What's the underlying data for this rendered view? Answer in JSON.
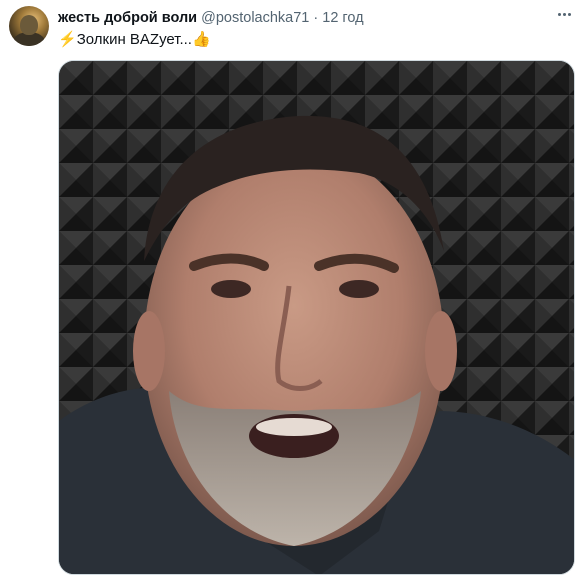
{
  "tweet": {
    "author_name": "жесть доброй воли",
    "author_handle": "@postolachka71",
    "separator": "·",
    "timestamp": "12 год",
    "text_emoji_prefix": "⚡",
    "text": "Золкин BAZует...",
    "text_emoji_suffix": "👍"
  },
  "icons": {
    "avatar": "profile-avatar",
    "more": "more-horizontal-icon",
    "media": "video-still"
  }
}
